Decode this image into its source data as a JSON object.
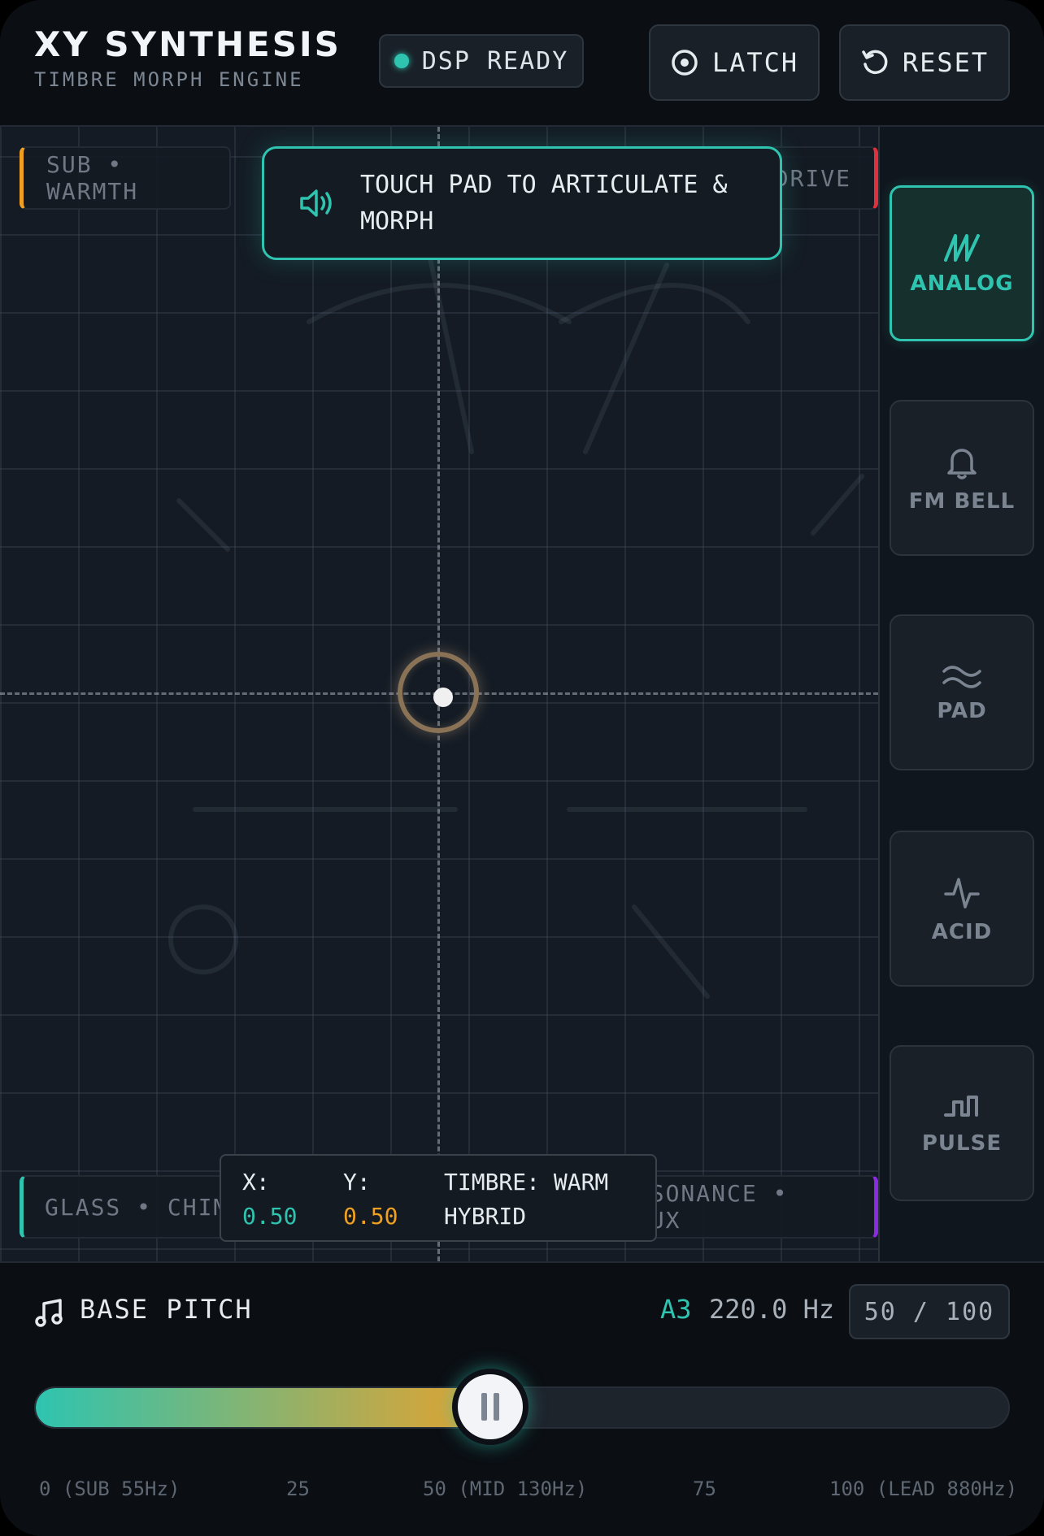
{
  "header": {
    "title": "XY SYNTHESIS",
    "subtitle": "TIMBRE MORPH ENGINE",
    "status": "DSP READY",
    "latch_label": "LATCH",
    "reset_label": "RESET"
  },
  "pad": {
    "corners": {
      "top_left": "SUB • WARMTH",
      "top_right": "IC • DRIVE",
      "bottom_left": "GLASS • CHIME",
      "bottom_right": "RESONANCE • FLUX"
    },
    "toast": "TOUCH PAD TO ARTICULATE & MORPH",
    "readout": {
      "x_label": "X:",
      "x_value": "0.50",
      "y_label": "Y:",
      "y_value": "0.50",
      "timbre": "TIMBRE: WARM HYBRID"
    },
    "cursor_x": 0.5,
    "cursor_y": 0.5
  },
  "presets": [
    {
      "label": "ANALOG",
      "icon": "analog-wave-icon",
      "active": true
    },
    {
      "label": "FM BELL",
      "icon": "bell-icon",
      "active": false
    },
    {
      "label": "PAD",
      "icon": "wave-icon",
      "active": false
    },
    {
      "label": "ACID",
      "icon": "pulse-line-icon",
      "active": false
    },
    {
      "label": "PULSE",
      "icon": "square-wave-icon",
      "active": false
    }
  ],
  "pitch": {
    "label": "BASE PITCH",
    "note": "A3",
    "hz": "220.0 Hz",
    "value_text": "50 / 100",
    "value": 50,
    "max": 100,
    "ticks": [
      "0 (SUB 55Hz)",
      "25",
      "50 (MID 130Hz)",
      "75",
      "100 (LEAD 880Hz)"
    ]
  },
  "colors": {
    "accent": "#2ec4b0",
    "warm": "#f0a020",
    "drive": "#e0303c",
    "flux": "#8a2be2"
  }
}
